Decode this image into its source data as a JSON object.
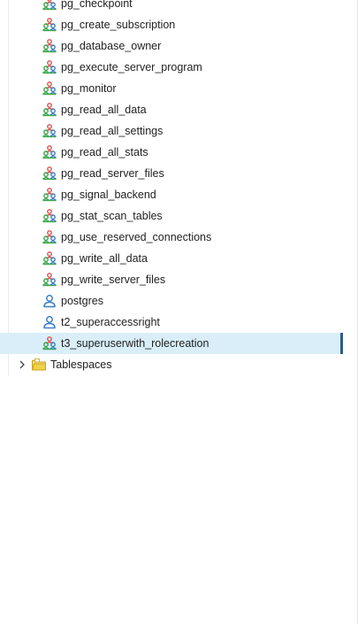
{
  "tree": {
    "roles": [
      {
        "label": "pg_checkpoint",
        "icon": "group-role-icon"
      },
      {
        "label": "pg_create_subscription",
        "icon": "group-role-icon"
      },
      {
        "label": "pg_database_owner",
        "icon": "group-role-icon"
      },
      {
        "label": "pg_execute_server_program",
        "icon": "group-role-icon"
      },
      {
        "label": "pg_monitor",
        "icon": "group-role-icon"
      },
      {
        "label": "pg_read_all_data",
        "icon": "group-role-icon"
      },
      {
        "label": "pg_read_all_settings",
        "icon": "group-role-icon"
      },
      {
        "label": "pg_read_all_stats",
        "icon": "group-role-icon"
      },
      {
        "label": "pg_read_server_files",
        "icon": "group-role-icon"
      },
      {
        "label": "pg_signal_backend",
        "icon": "group-role-icon"
      },
      {
        "label": "pg_stat_scan_tables",
        "icon": "group-role-icon"
      },
      {
        "label": "pg_use_reserved_connections",
        "icon": "group-role-icon"
      },
      {
        "label": "pg_write_all_data",
        "icon": "group-role-icon"
      },
      {
        "label": "pg_write_server_files",
        "icon": "group-role-icon"
      },
      {
        "label": "postgres",
        "icon": "login-role-icon"
      },
      {
        "label": "t2_superaccessright",
        "icon": "login-role-icon"
      },
      {
        "label": "t3_superuserwith_rolecreation",
        "icon": "group-role-icon",
        "selected": true
      }
    ],
    "tablespaces": {
      "label": "Tablespaces",
      "icon": "folder-icon",
      "expanded": false
    },
    "colors": {
      "selection_bg": "#d9eef9",
      "selection_bar": "#2c5b8a",
      "role_red": "#d9534f",
      "role_green": "#3aa64a",
      "role_blue": "#3b7fc4",
      "folder_yellow": "#f2d14a"
    }
  }
}
